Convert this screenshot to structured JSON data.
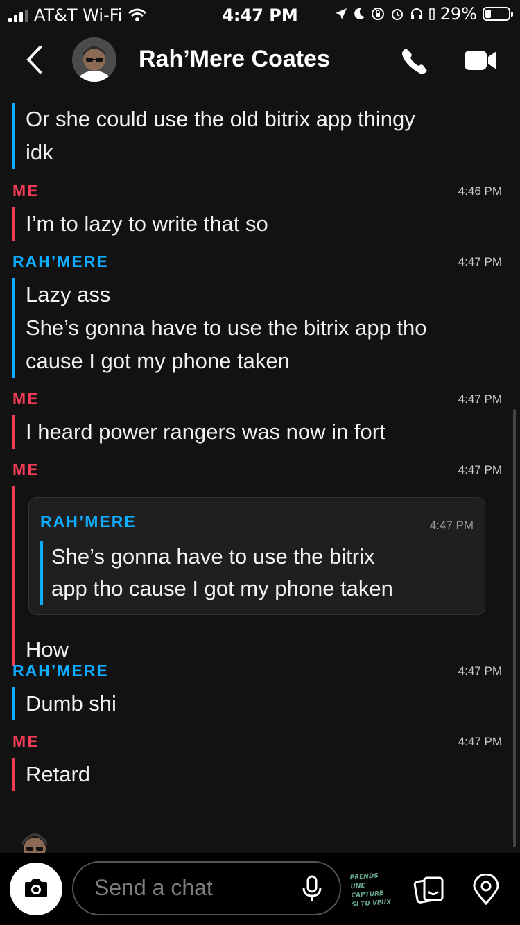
{
  "status_bar": {
    "carrier": "AT&T Wi-Fi",
    "time": "4:47 PM",
    "battery": "29%"
  },
  "header": {
    "title": "Rah’Mere Coates"
  },
  "messages": [
    {
      "lines": [
        "Or she could use the old bitrix app thingy",
        "idk"
      ]
    },
    {
      "sender": "ME",
      "time": "4:46 PM",
      "lines": [
        "I’m to lazy to write that so"
      ]
    },
    {
      "sender": "RAH’MERE",
      "time": "4:47 PM",
      "lines": [
        "Lazy ass",
        "She’s gonna have to use the bitrix app tho",
        "cause I got my phone taken"
      ]
    },
    {
      "sender": "ME",
      "time": "4:47 PM",
      "lines": [
        "I heard power rangers was now in fort"
      ]
    },
    {
      "sender": "ME",
      "time": "4:47 PM",
      "quote": {
        "sender": "RAH’MERE",
        "time": "4:47 PM",
        "lines": [
          "She’s gonna have to use the bitrix",
          "app tho cause I got my phone taken"
        ]
      },
      "lines": [
        "How"
      ]
    },
    {
      "sender": "RAH’MERE",
      "time": "4:47 PM",
      "lines": [
        "Dumb shi"
      ]
    },
    {
      "sender": "ME",
      "time": "4:47 PM",
      "lines": [
        "Retard"
      ]
    }
  ],
  "composer": {
    "placeholder": "Send a chat",
    "sticker_text": [
      "PRENDS UNE",
      "CAPTURE",
      "SI TU VEUX"
    ]
  },
  "icons": {
    "back": "chevron-left-icon",
    "call": "phone-icon",
    "video": "video-camera-icon",
    "camera": "camera-icon",
    "mic": "microphone-icon",
    "memories": "memories-icon",
    "location": "location-pin-icon"
  },
  "colors": {
    "me": "#f23c57",
    "them": "#0fadff",
    "background": "#121212"
  }
}
